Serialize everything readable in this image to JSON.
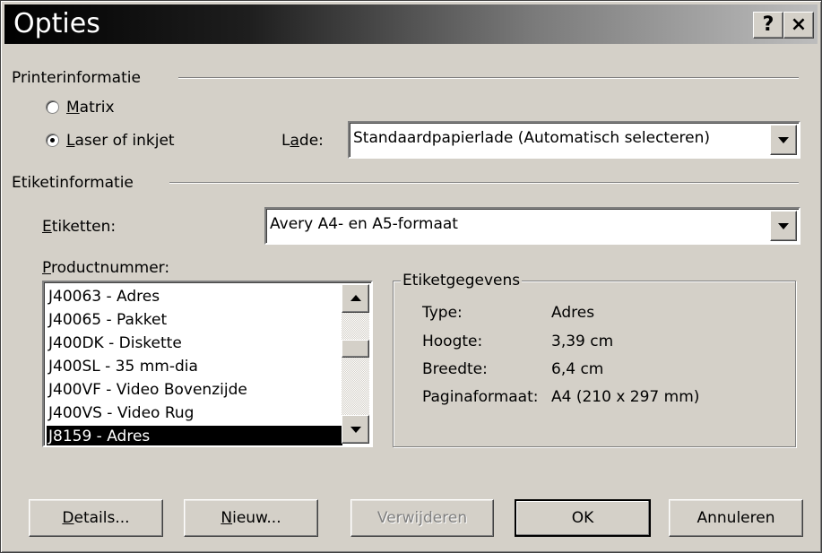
{
  "window": {
    "title": "Opties",
    "help_label": "?",
    "close_label": "×"
  },
  "printer": {
    "section_label": "Printerinformatie",
    "matrix": {
      "accel": "M",
      "rest": "atrix",
      "selected": false
    },
    "laser": {
      "accel": "L",
      "rest": "aser of inkjet",
      "selected": true
    },
    "tray_label": {
      "pre": "L",
      "accel": "a",
      "post": "de:"
    },
    "tray_value": "Standaardpapierlade (Automatisch selecteren)"
  },
  "label_info": {
    "section_label": "Etiketinformatie",
    "labels_caption": {
      "accel": "E",
      "rest": "tiketten:"
    },
    "labels_value": "Avery A4- en A5-formaat",
    "product_caption": {
      "accel": "P",
      "rest": "roductnummer:"
    },
    "products": [
      "J40063 - Adres",
      "J40065 - Pakket",
      "J400DK - Diskette",
      "J400SL - 35 mm-dia",
      "J400VF - Video Bovenzijde",
      "J400VS - Video Rug",
      "J8159 - Adres"
    ],
    "selected_product": "J8159 - Adres"
  },
  "details": {
    "group_label": "Etiketgegevens",
    "rows": [
      {
        "label": "Type:",
        "value": "Adres"
      },
      {
        "label": "Hoogte:",
        "value": "3,39 cm"
      },
      {
        "label": "Breedte:",
        "value": "6,4 cm"
      },
      {
        "label": "Paginaformaat:",
        "value": "A4 (210 x 297 mm)"
      }
    ]
  },
  "buttons": {
    "details": {
      "accel": "D",
      "rest": "etails..."
    },
    "new": {
      "accel": "N",
      "rest": "ieuw..."
    },
    "delete": "Verwijderen",
    "ok": "OK",
    "cancel": "Annuleren"
  }
}
